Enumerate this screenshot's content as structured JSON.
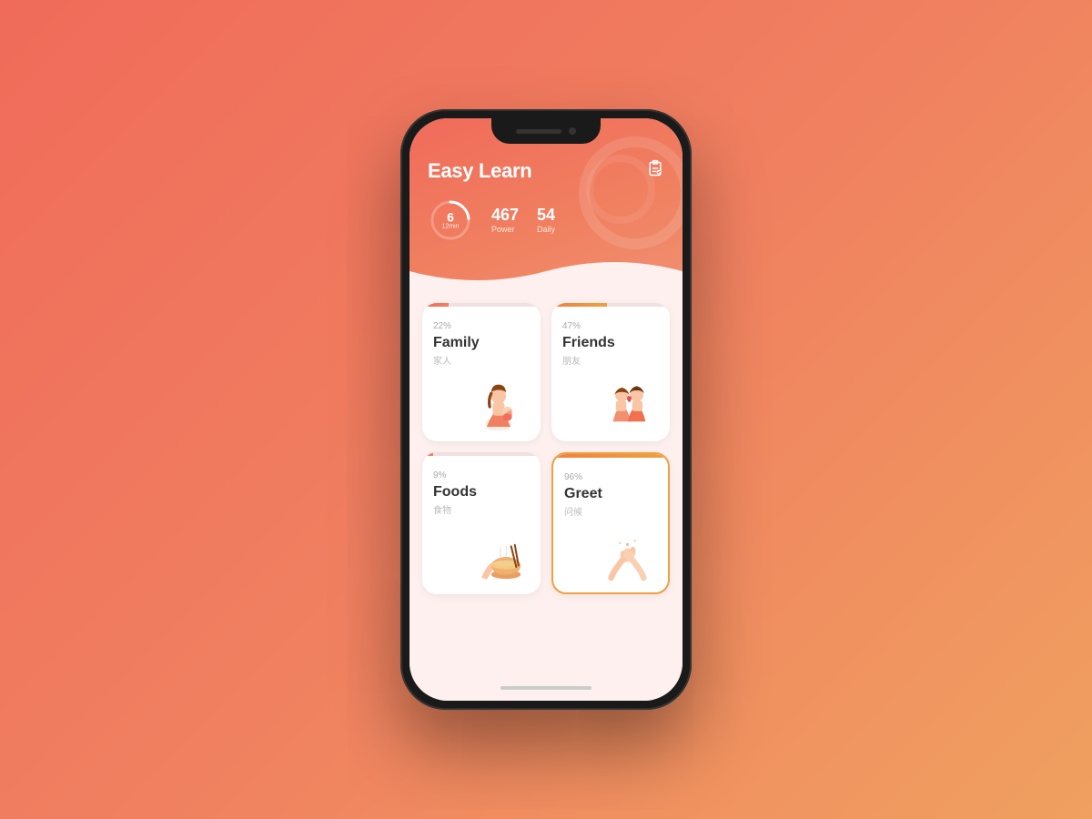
{
  "app": {
    "title": "Easy Learn",
    "icon": "📋"
  },
  "stats": {
    "timer_value": "6",
    "timer_label": "12min",
    "power_value": "467",
    "power_label": "Power",
    "daily_value": "54",
    "daily_label": "Daily"
  },
  "cards": [
    {
      "id": "family",
      "title": "Family",
      "subtitle": "家人",
      "percent": "22%",
      "progress": 22,
      "color_class": "card-family"
    },
    {
      "id": "friends",
      "title": "Friends",
      "subtitle": "朋友",
      "percent": "47%",
      "progress": 47,
      "color_class": "card-friends"
    },
    {
      "id": "foods",
      "title": "Foods",
      "subtitle": "食物",
      "percent": "9%",
      "progress": 9,
      "color_class": "card-foods"
    },
    {
      "id": "greet",
      "title": "Greet",
      "subtitle": "问候",
      "percent": "96%",
      "progress": 96,
      "color_class": "card-greet"
    }
  ]
}
